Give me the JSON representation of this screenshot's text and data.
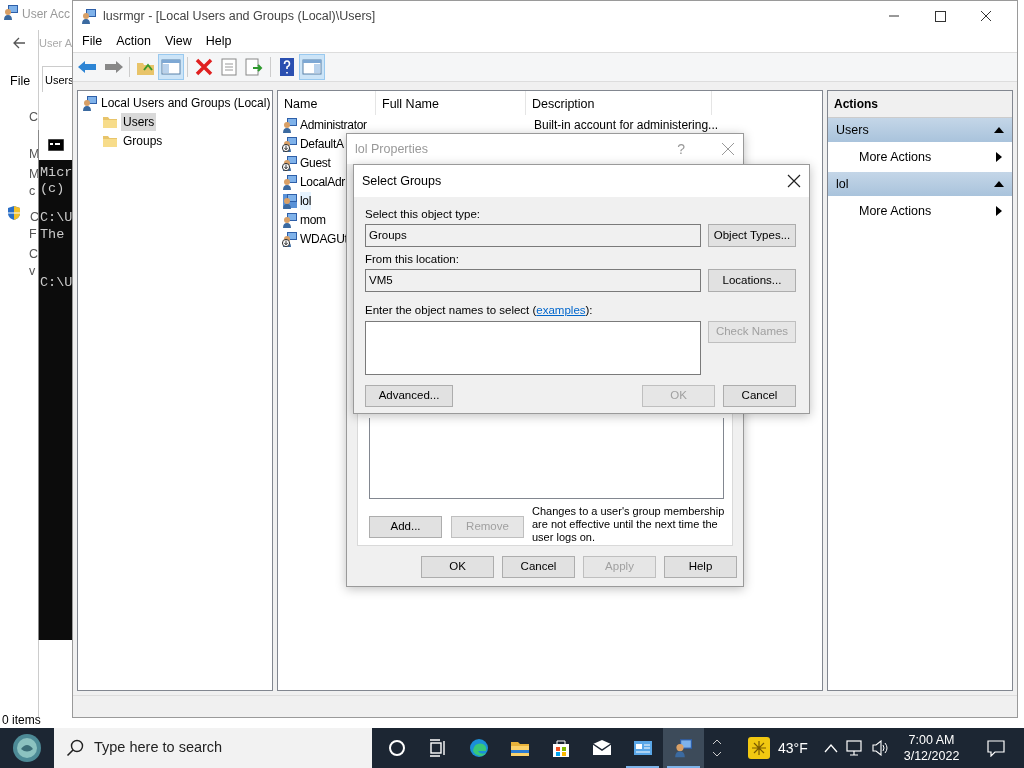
{
  "background": {
    "title": "User Acc",
    "sub_title": "User A",
    "menu": "File",
    "tab": "Users",
    "fragments": [
      "C",
      "M",
      "M",
      "c",
      "C",
      "F",
      "C",
      "v"
    ],
    "status": "0 items"
  },
  "console": {
    "lines": [
      "Micr",
      "(c)",
      "C:\\U",
      "The",
      "C:\\U"
    ]
  },
  "main_window": {
    "title": "lusrmgr - [Local Users and Groups (Local)\\Users]",
    "menu": [
      "File",
      "Action",
      "View",
      "Help"
    ],
    "tree": {
      "label": "Local Users and Groups (Local)",
      "children": [
        {
          "label": "Users",
          "selected": true
        },
        {
          "label": "Groups",
          "selected": false
        }
      ]
    },
    "columns": [
      "Name",
      "Full Name",
      "Description"
    ],
    "rows": [
      {
        "name": "Administrator",
        "description": "Built-in account for administering...",
        "disabled": false,
        "selected": false
      },
      {
        "name": "DefaultA",
        "disabled": true,
        "selected": false
      },
      {
        "name": "Guest",
        "disabled": true,
        "selected": false
      },
      {
        "name": "LocalAdr",
        "disabled": false,
        "selected": false
      },
      {
        "name": "lol",
        "disabled": false,
        "selected": true
      },
      {
        "name": "mom",
        "disabled": false,
        "selected": false
      },
      {
        "name": "WDAGUt",
        "disabled": true,
        "selected": false
      }
    ],
    "actions": {
      "title": "Actions",
      "sections": [
        {
          "label": "Users",
          "items": [
            "More Actions"
          ]
        },
        {
          "label": "lol",
          "items": [
            "More Actions"
          ]
        }
      ]
    }
  },
  "properties_dialog": {
    "title": "lol Properties",
    "help": "?",
    "buttons": [
      {
        "label": "Add...",
        "disabled": false
      },
      {
        "label": "Remove",
        "disabled": true
      }
    ],
    "note": "Changes to a user's group membership are not effective until the next time the user logs on.",
    "footer_buttons": [
      {
        "label": "OK",
        "disabled": false
      },
      {
        "label": "Cancel",
        "disabled": false
      },
      {
        "label": "Apply",
        "disabled": true
      },
      {
        "label": "Help",
        "disabled": false
      }
    ]
  },
  "select_groups": {
    "title": "Select Groups",
    "object_type_label": "Select this object type:",
    "object_type": "Groups",
    "object_types_button": "Object Types...",
    "location_label": "From this location:",
    "location": "VM5",
    "locations_button": "Locations...",
    "names_label": "Enter the object names to select (",
    "link": "examples",
    "names_label_end": "):",
    "check_names": {
      "label": "Check Names",
      "disabled": true
    },
    "advanced": "Advanced...",
    "ok": {
      "label": "OK",
      "disabled": true
    },
    "cancel": {
      "label": "Cancel",
      "disabled": false
    }
  },
  "taskbar": {
    "search_placeholder": "Type here to search",
    "apps": [
      {
        "kind": "cortana",
        "selected": false,
        "open": false
      },
      {
        "kind": "taskview",
        "selected": false,
        "open": false
      },
      {
        "kind": "edge",
        "selected": false,
        "open": false
      },
      {
        "kind": "explorer",
        "selected": false,
        "open": false
      },
      {
        "kind": "store",
        "selected": false,
        "open": false
      },
      {
        "kind": "mail",
        "selected": false,
        "open": false
      },
      {
        "kind": "control",
        "selected": false,
        "open": true
      },
      {
        "kind": "users",
        "selected": true,
        "open": true
      }
    ],
    "temperature": "43°F",
    "time": "7:00 AM",
    "date": "3/12/2022"
  }
}
